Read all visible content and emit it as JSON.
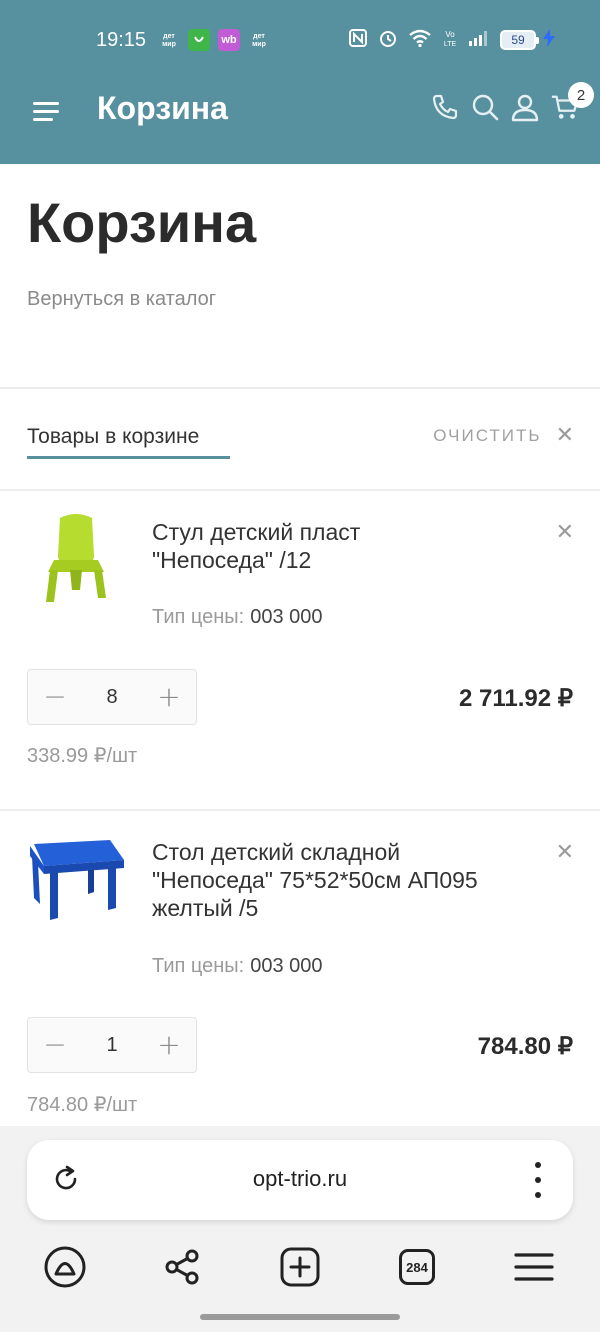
{
  "status_bar": {
    "time": "19:15",
    "app_icons": [
      {
        "name": "detmir-icon",
        "label": "дет мир",
        "color": "#6f8fa0"
      },
      {
        "name": "green-app-icon",
        "label": "",
        "color": "#3fb54a"
      },
      {
        "name": "wb-icon",
        "label": "wb",
        "color": "#c25cd6"
      },
      {
        "name": "detmir-icon-2",
        "label": "дет мир",
        "color": "#6f8fa0"
      }
    ],
    "battery_level": "59"
  },
  "header": {
    "title": "Корзина",
    "cart_count": "2"
  },
  "page": {
    "title": "Корзина",
    "back_link": "Вернуться в каталог",
    "tab_label": "Товары в корзине",
    "clear_label": "ОЧИСТИТЬ"
  },
  "items": [
    {
      "name_line1": "Стул детский пласт",
      "name_line2": "\"Непоседа\" /12",
      "name_line3": "",
      "price_type_label": "Тип цены:",
      "price_type_value": "003 000",
      "quantity": "8",
      "total": "2 711.92 ₽",
      "unit_price": "338.99 ₽/шт",
      "image_color": "#b5dc2e"
    },
    {
      "name_line1": "Стол детский складной",
      "name_line2": "\"Непоседа\" 75*52*50см АП095",
      "name_line3": "желтый /5",
      "price_type_label": "Тип цены:",
      "price_type_value": "003 000",
      "quantity": "1",
      "total": "784.80 ₽",
      "unit_price": "784.80 ₽/шт",
      "image_color": "#1e54c8"
    }
  ],
  "browser": {
    "url": "opt-trio.ru",
    "tabs_count": "284"
  },
  "colors": {
    "accent": "#57909f"
  }
}
